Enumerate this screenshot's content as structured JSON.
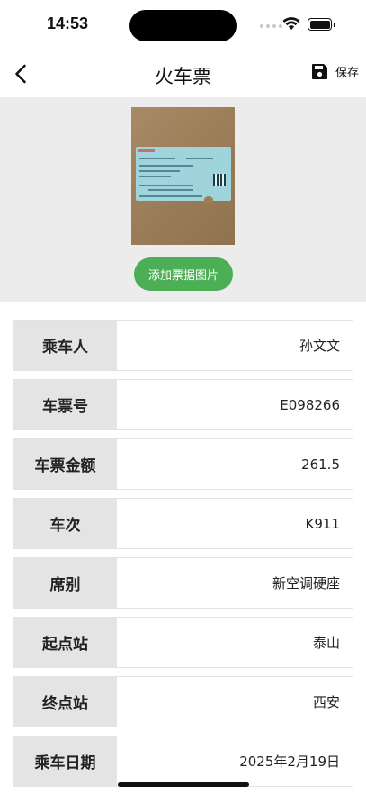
{
  "status_bar": {
    "time": "14:53"
  },
  "nav": {
    "title": "火车票",
    "save_label": "保存",
    "back_icon": "chevron-left-icon",
    "save_icon": "floppy-disk-icon"
  },
  "image_section": {
    "add_button_label": "添加票据图片",
    "button_color": "#4caf56"
  },
  "fields": [
    {
      "label": "乘车人",
      "value": "孙文文"
    },
    {
      "label": "车票号",
      "value": "E098266"
    },
    {
      "label": "车票金额",
      "value": "261.5"
    },
    {
      "label": "车次",
      "value": "K911"
    },
    {
      "label": "席别",
      "value": "新空调硬座"
    },
    {
      "label": "起点站",
      "value": "泰山"
    },
    {
      "label": "终点站",
      "value": "西安"
    },
    {
      "label": "乘车日期",
      "value": "2025年2月19日"
    }
  ]
}
